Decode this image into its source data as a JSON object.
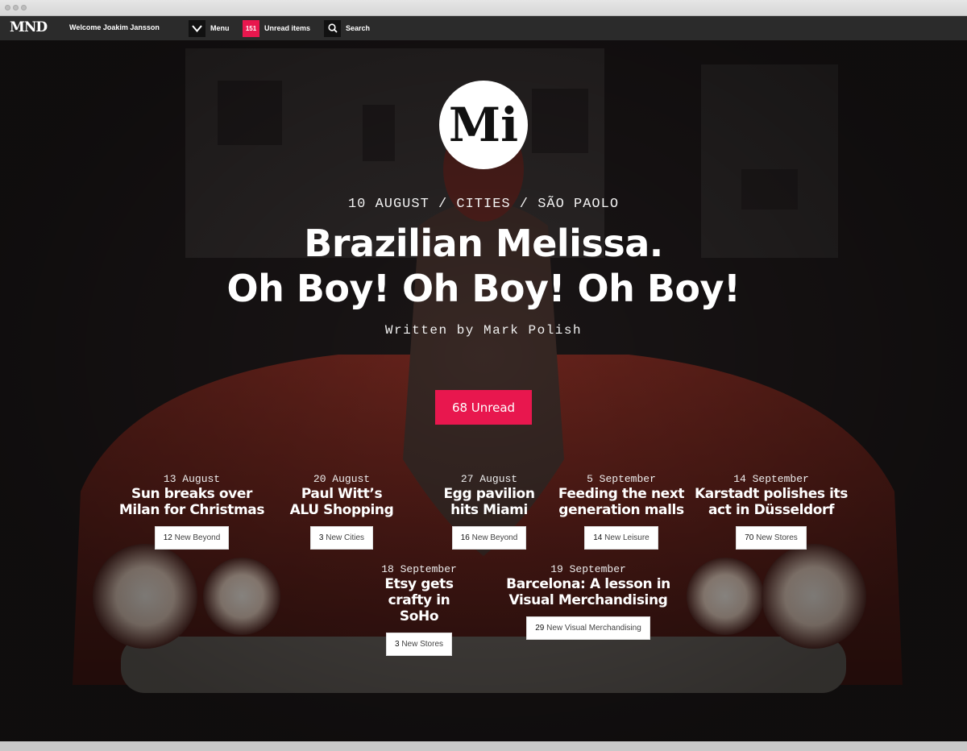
{
  "header": {
    "logo": "MND",
    "welcome": "Welcome Joakim Jansson",
    "menu_label": "Menu",
    "unread_count": "151",
    "unread_label": "Unread items",
    "search_label": "Search"
  },
  "hero": {
    "emblem": "Mi",
    "meta": "10 AUGUST / CITIES / SÃO PAOLO",
    "title_line1": "Brazilian Melissa.",
    "title_line2": "Oh Boy! Oh Boy! Oh Boy!",
    "byline": "Written by Mark Polish",
    "unread_button": "68  Unread"
  },
  "stories": [
    {
      "date": "13 August",
      "title": "Sun breaks over Milan for Christmas",
      "count": "12",
      "tag": "New Beyond"
    },
    {
      "date": "20 August",
      "title": "Paul Witt’s ALU Shopping",
      "count": "3",
      "tag": "New Cities"
    },
    {
      "date": "27 August",
      "title": "Egg pavilion hits Miami",
      "count": "16",
      "tag": "New Beyond"
    },
    {
      "date": "5 September",
      "title": "Feeding the next generation malls",
      "count": "14",
      "tag": "New Leisure"
    },
    {
      "date": "14 September",
      "title": "Karstadt polishes its act in Düsseldorf",
      "count": "70",
      "tag": "New Stores"
    },
    {
      "date": "18 September",
      "title": "Etsy gets crafty in SoHo",
      "count": "3",
      "tag": "New Stores"
    },
    {
      "date": "19 September",
      "title": "Barcelona: A lesson in Visual Merchandising",
      "count": "29",
      "tag": "New Visual Merchandising"
    }
  ],
  "colors": {
    "accent": "#e8174e",
    "header_bg": "#2b2b2b"
  }
}
